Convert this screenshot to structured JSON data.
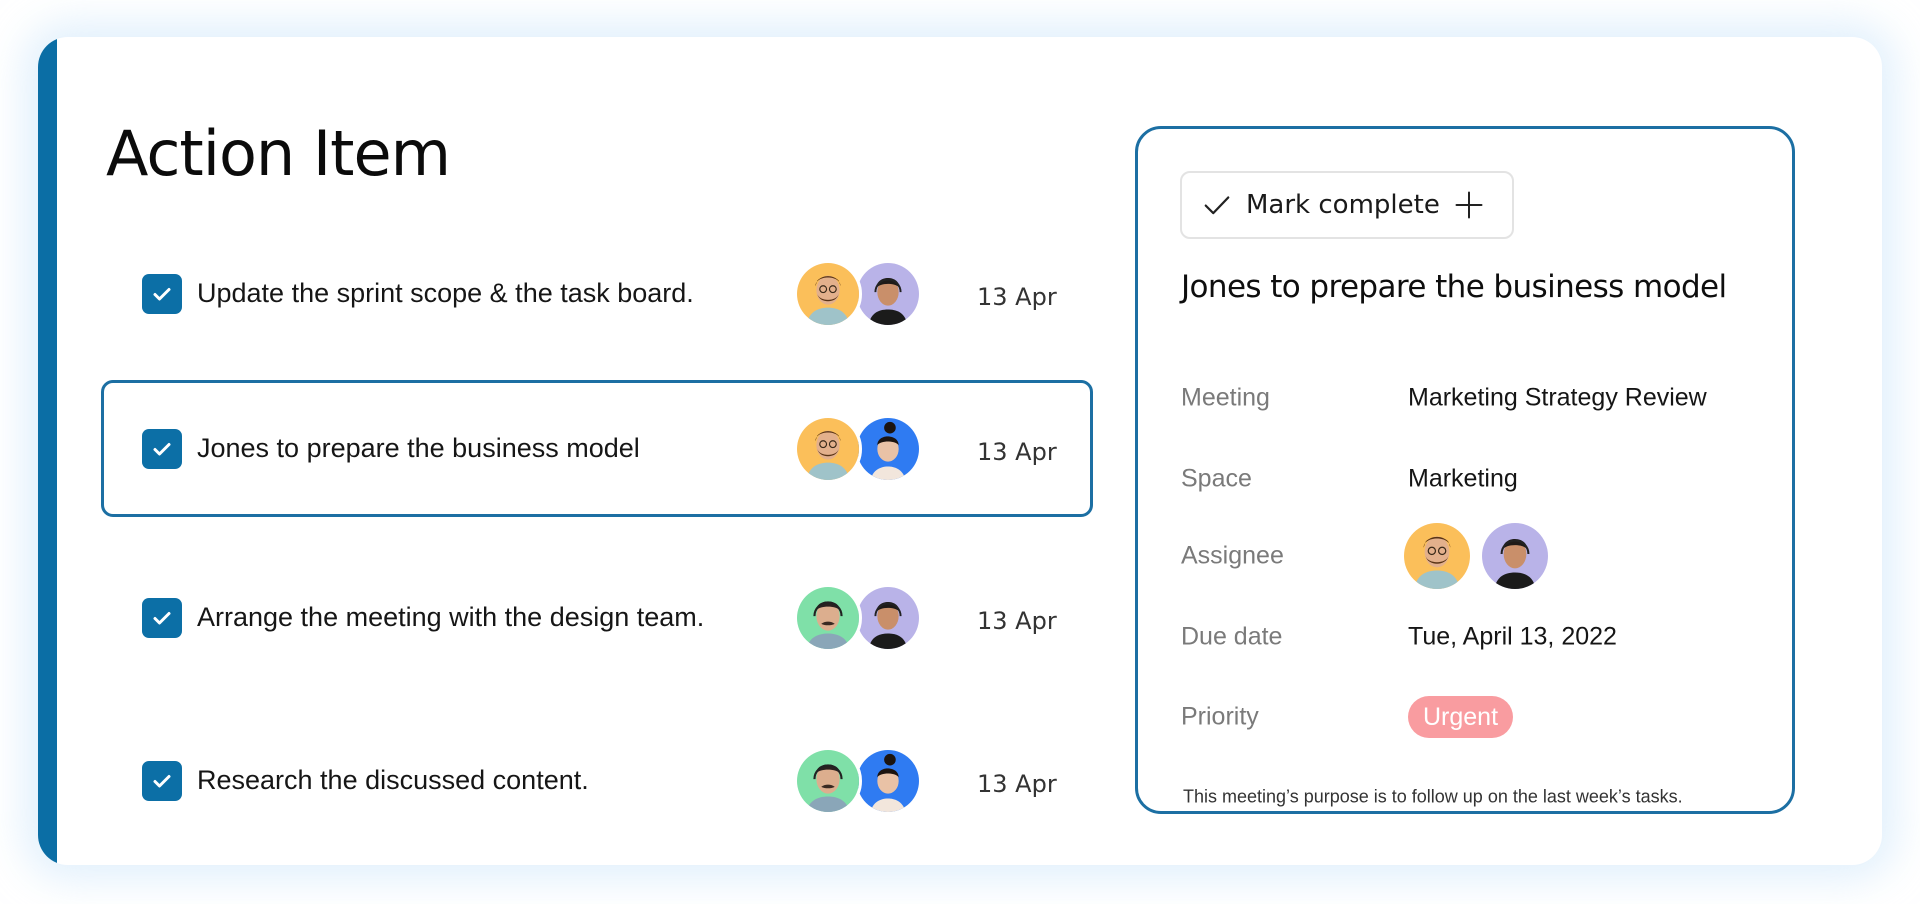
{
  "page": {
    "title": "Action Item"
  },
  "tasks": [
    {
      "label": "Update the sprint scope & the task board.",
      "date": "13 Apr",
      "checked": true,
      "selected": false,
      "assignees": [
        {
          "name": "bearded-man-glasses",
          "bg": "#fbbf5a"
        },
        {
          "name": "woman-headset",
          "bg": "#b9b3e8"
        }
      ]
    },
    {
      "label": "Jones to prepare the business model",
      "date": "13 Apr",
      "checked": true,
      "selected": true,
      "assignees": [
        {
          "name": "bearded-man-glasses",
          "bg": "#fbbf5a"
        },
        {
          "name": "woman-bun",
          "bg": "#2f7bf2"
        }
      ]
    },
    {
      "label": "Arrange the meeting with the design team.",
      "date": "13 Apr",
      "checked": true,
      "selected": false,
      "assignees": [
        {
          "name": "man-mustache-headset",
          "bg": "#7fe0a8"
        },
        {
          "name": "woman-headset",
          "bg": "#b9b3e8"
        }
      ]
    },
    {
      "label": "Research the discussed content.",
      "date": "13 Apr",
      "checked": true,
      "selected": false,
      "assignees": [
        {
          "name": "man-mustache-headset",
          "bg": "#7fe0a8"
        },
        {
          "name": "woman-bun",
          "bg": "#2f7bf2"
        }
      ]
    }
  ],
  "detail": {
    "mark_complete_label": "Mark complete",
    "check_icon": "check-icon",
    "plus_icon": "plus-icon",
    "title": "Jones to prepare the business model",
    "fields": {
      "meeting_label": "Meeting",
      "meeting_value": "Marketing Strategy Review",
      "space_label": "Space",
      "space_value": "Marketing",
      "assignee_label": "Assignee",
      "due_date_label": "Due date",
      "due_date_value": "Tue, April 13, 2022",
      "priority_label": "Priority",
      "priority_value": "Urgent"
    },
    "assignees": [
      {
        "name": "bearded-man-glasses",
        "bg": "#fbbf5a"
      },
      {
        "name": "woman-headset",
        "bg": "#b9b3e8"
      }
    ],
    "note": "This meeting’s purpose is to follow up on the last week’s tasks."
  },
  "colors": {
    "accent": "#0b6ea5",
    "checkbox": "#0c6fa6",
    "selected_border": "#1c6fa3",
    "urgent_badge": "#f99ca0"
  }
}
